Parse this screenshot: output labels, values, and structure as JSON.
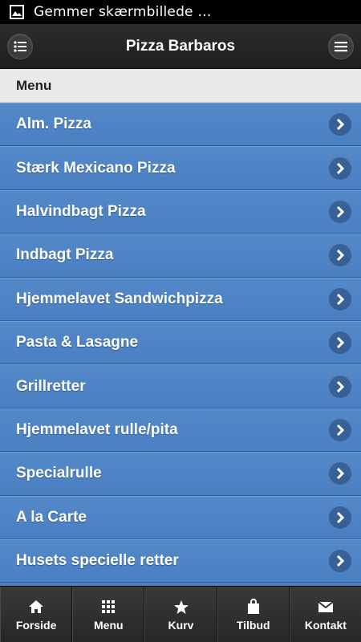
{
  "status_bar": {
    "text": "Gemmer skærmbillede …",
    "icon": "image-icon"
  },
  "header": {
    "title": "Pizza Barbaros",
    "left_icon": "list-icon",
    "right_icon": "hamburger-menu-icon"
  },
  "section": {
    "title": "Menu"
  },
  "menu_items": [
    {
      "label": "Alm. Pizza"
    },
    {
      "label": "Stærk Mexicano Pizza"
    },
    {
      "label": "Halvindbagt Pizza"
    },
    {
      "label": "Indbagt Pizza"
    },
    {
      "label": "Hjemmelavet Sandwichpizza"
    },
    {
      "label": "Pasta & Lasagne"
    },
    {
      "label": "Grillretter"
    },
    {
      "label": "Hjemmelavet rulle/pita"
    },
    {
      "label": "Specialrulle"
    },
    {
      "label": "A la Carte"
    },
    {
      "label": "Husets specielle retter"
    }
  ],
  "bottom_nav": [
    {
      "label": "Forside",
      "icon": "home-icon"
    },
    {
      "label": "Menu",
      "icon": "grid-icon"
    },
    {
      "label": "Kurv",
      "icon": "star-icon"
    },
    {
      "label": "Tilbud",
      "icon": "shopping-bag-icon"
    },
    {
      "label": "Kontakt",
      "icon": "mail-icon"
    }
  ],
  "colors": {
    "list_background": "#4a7fc1",
    "header_background": "#262626",
    "section_background": "#e9e9e9"
  }
}
